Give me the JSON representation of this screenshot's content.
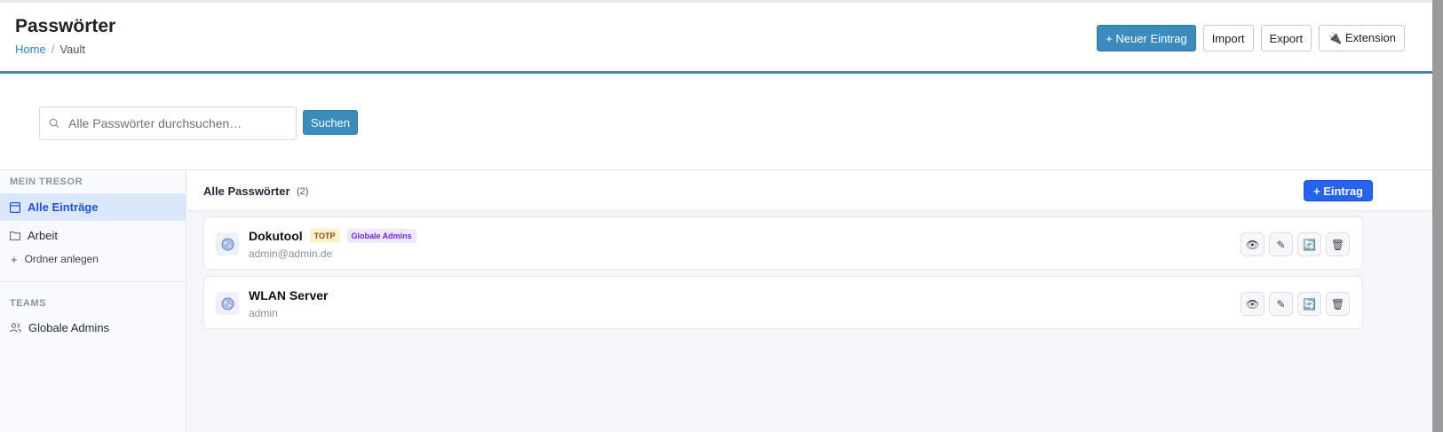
{
  "header": {
    "title": "Passwörter",
    "breadcrumb": {
      "home": "Home",
      "separator": "/",
      "current": "Vault"
    },
    "actions": {
      "new_entry": "+ Neuer Eintrag",
      "import": "Import",
      "export": "Export",
      "extension": "🔌 Extension"
    }
  },
  "search": {
    "placeholder": "Alle Passwörter durchsuchen…",
    "value": "",
    "button": "Suchen"
  },
  "sidebar": {
    "vault_label": "MEIN TRESOR",
    "items": [
      {
        "label": "Alle Einträge",
        "icon": "list-icon",
        "active": true
      },
      {
        "label": "Arbeit",
        "icon": "folder-icon",
        "active": false
      }
    ],
    "add_folder": "Ordner anlegen",
    "teams_label": "TEAMS",
    "teams": [
      {
        "label": "Globale Admins",
        "icon": "users-icon"
      }
    ]
  },
  "main": {
    "title": "Alle Passwörter",
    "count": "(2)",
    "add_button": "+ Eintrag",
    "entries": [
      {
        "title": "Dokutool",
        "username": "admin@admin.de",
        "badges": [
          "TOTP",
          "Globale Admins"
        ],
        "icon": "globe-icon"
      },
      {
        "title": "WLAN Server",
        "username": "admin",
        "badges": [],
        "icon": "globe-icon"
      }
    ],
    "entry_actions": {
      "view": "👁",
      "edit": "✎",
      "refresh": "🔄",
      "delete": "🗑"
    }
  },
  "colors": {
    "accent": "#3b8bbd",
    "primary_button": "#2563eb",
    "header_border": "#3b87ad",
    "active_item_bg": "#dbe8fb"
  }
}
